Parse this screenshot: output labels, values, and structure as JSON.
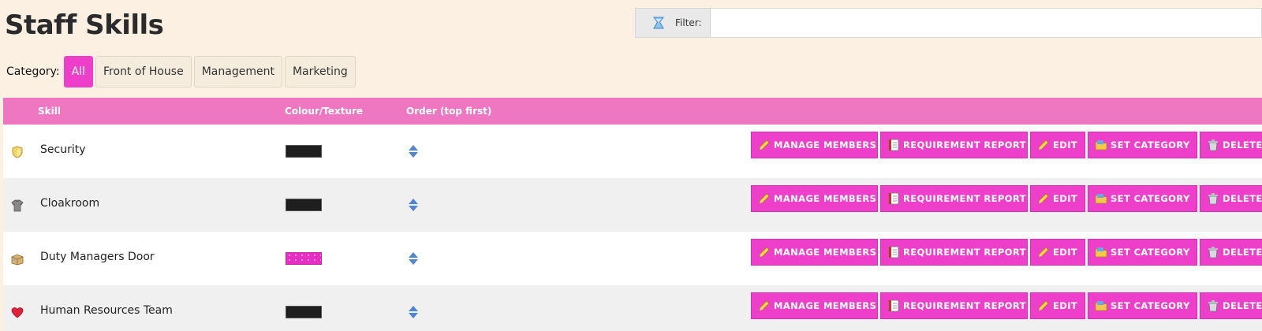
{
  "page": {
    "title": "Staff Skills"
  },
  "filter": {
    "label": "Filter:",
    "value": "",
    "placeholder": ""
  },
  "category_bar": {
    "label": "Category:",
    "options": [
      "All",
      "Front of House",
      "Management",
      "Marketing"
    ],
    "selected": "All"
  },
  "table": {
    "headers": {
      "skill": "Skill",
      "colour": "Colour/Texture",
      "order": "Order (top first)"
    },
    "rows": [
      {
        "icon": "shield-icon",
        "name": "Security",
        "colour": "#1e1e1e",
        "texture": "solid"
      },
      {
        "icon": "shirt-icon",
        "name": "Cloakroom",
        "colour": "#1e1e1e",
        "texture": "solid"
      },
      {
        "icon": "box-icon",
        "name": "Duty Managers Door",
        "colour": "#e92fc3",
        "texture": "dotted"
      },
      {
        "icon": "heart-icon",
        "name": "Human Resources Team",
        "colour": "#1e1e1e",
        "texture": "solid"
      }
    ]
  },
  "actions": {
    "manage_members": "MANAGE MEMBERS",
    "requirement_report": "REQUIREMENT REPORT",
    "edit": "EDIT",
    "set_category": "SET CATEGORY",
    "delete": "DELETE"
  },
  "colors": {
    "accent": "#ee3fca",
    "header_bar": "#ef76c1",
    "page_background": "#fbf0e1",
    "row_alt": "#f0f0f0"
  }
}
